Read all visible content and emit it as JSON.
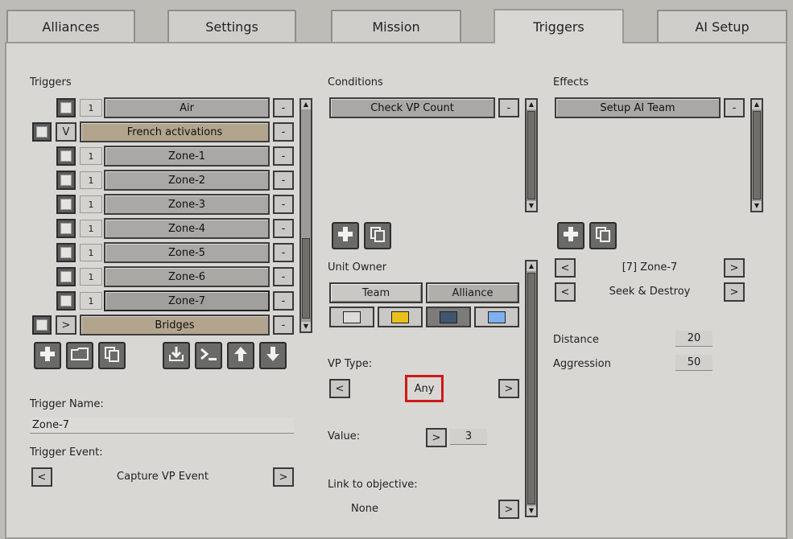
{
  "tabs": [
    {
      "label": "Alliances",
      "active": false
    },
    {
      "label": "Settings",
      "active": false
    },
    {
      "label": "Mission",
      "active": false
    },
    {
      "label": "Triggers",
      "active": true
    },
    {
      "label": "AI Setup",
      "active": false
    }
  ],
  "triggers": {
    "heading": "Triggers",
    "items": [
      {
        "num": "1",
        "label": "Air"
      },
      {
        "num": "V",
        "label": "French activations"
      },
      {
        "num": "1",
        "label": "Zone-1"
      },
      {
        "num": "1",
        "label": "Zone-2"
      },
      {
        "num": "1",
        "label": "Zone-3"
      },
      {
        "num": "1",
        "label": "Zone-4"
      },
      {
        "num": "1",
        "label": "Zone-5"
      },
      {
        "num": "1",
        "label": "Zone-6"
      },
      {
        "num": "1",
        "label": "Zone-7"
      },
      {
        "num": ">",
        "label": "Bridges"
      }
    ],
    "remove_label": "-",
    "name_label": "Trigger Name:",
    "name_value": "Zone-7",
    "event_label": "Trigger Event:",
    "event_value": "Capture VP Event",
    "prev": "<",
    "next": ">"
  },
  "conditions": {
    "heading": "Conditions",
    "item": "Check VP Count",
    "remove_label": "-",
    "unit_owner_label": "Unit Owner",
    "owner_team": "Team",
    "owner_alliance": "Alliance",
    "swatch_colors": [
      "#dcdcdc",
      "#e8c21a",
      "#3f5570",
      "#7fb0f0"
    ],
    "vp_type_label": "VP Type:",
    "vp_type_value": "Any",
    "highlight_color": "#d01818",
    "value_label": "Value:",
    "value_value": "3",
    "link_label": "Link to objective:",
    "link_value": "None",
    "prev": "<",
    "next": ">"
  },
  "effects": {
    "heading": "Effects",
    "item": "Setup AI Team",
    "remove_label": "-",
    "zone_value": "[7] Zone-7",
    "order_value": "Seek & Destroy",
    "distance_label": "Distance",
    "distance_value": "20",
    "aggression_label": "Aggression",
    "aggression_value": "50",
    "prev": "<",
    "next": ">"
  },
  "icons": {
    "add": "plus-icon",
    "folder": "folder-icon",
    "copy": "copy-icon",
    "import": "import-icon",
    "console": "console-icon",
    "up": "arrow-up-icon",
    "down": "arrow-down-icon"
  }
}
